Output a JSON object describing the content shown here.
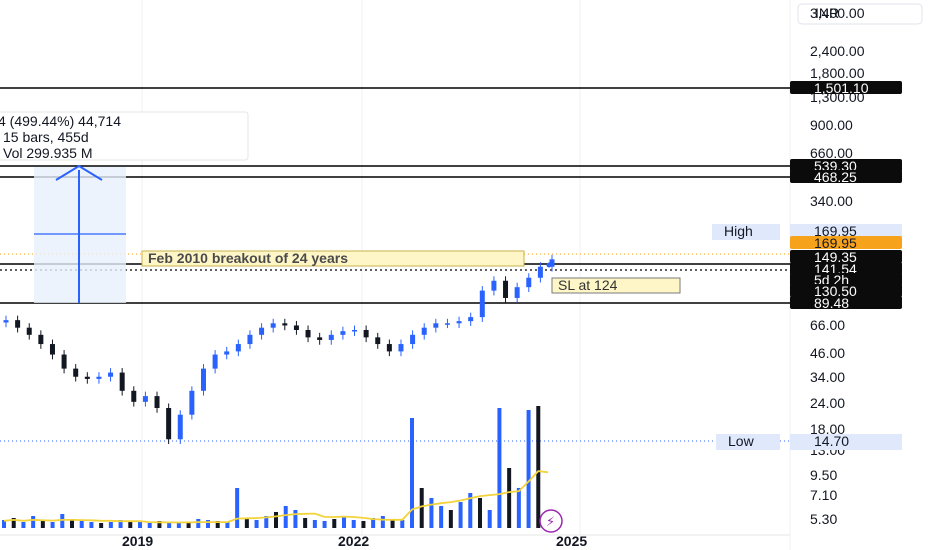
{
  "header": {
    "currency": "INR"
  },
  "measure_tooltip": {
    "line1": "4 (499.44%) 44,714",
    "line2": "15 bars, 455d",
    "line3": "Vol 299.935 M"
  },
  "annotations": {
    "breakout_label": "Feb 2010 breakout of 24 years",
    "stop_loss_label": "SL at 124"
  },
  "markers": {
    "high_label": "High",
    "high_value": "169.95",
    "low_label": "Low",
    "low_value": "14.70"
  },
  "colors": {
    "accent": "#2962ff",
    "candle": "#2962ff",
    "line_black": "#000000",
    "price_tag_orange": "#f7a21b",
    "label_yellow": "#fff6c8",
    "label_blue": "#dfe9fb",
    "volume_ma": "#f2d33a"
  },
  "chart_data": {
    "type": "candlestick",
    "y_scale": "log",
    "x_axis_ticks": [
      "2019",
      "2022",
      "2025"
    ],
    "y_axis_ticks": [
      "3,400.00",
      "2,400.00",
      "1,800.00",
      "1,300.00",
      "900.00",
      "660.00",
      "340.00",
      "66.00",
      "46.00",
      "34.00",
      "24.00",
      "18.00",
      "13.00",
      "9.50",
      "7.10",
      "5.30"
    ],
    "price_tags": [
      {
        "value": "1,501.10",
        "style": "dark"
      },
      {
        "value": "539.30",
        "style": "dark"
      },
      {
        "value": "468.25",
        "style": "dark"
      },
      {
        "value": "169.95",
        "style": "orange"
      },
      {
        "value": "149.35",
        "style": "dark"
      },
      {
        "value": "141.54",
        "style": "dark"
      },
      {
        "value": "5d 2h",
        "style": "dark"
      },
      {
        "value": "130.50",
        "style": "dark"
      },
      {
        "value": "89.48",
        "style": "dark"
      }
    ],
    "horizontal_levels": [
      1501.1,
      539.3,
      468.25,
      149.35,
      130.5,
      89.48
    ],
    "approx_close_series": [
      75,
      68,
      62,
      55,
      48,
      40,
      36,
      35,
      36,
      38,
      30,
      26,
      28,
      24,
      16,
      22,
      30,
      40,
      48,
      50,
      55,
      62,
      68,
      72,
      70,
      66,
      60,
      58,
      62,
      65,
      66,
      60,
      55,
      50,
      55,
      62,
      68,
      72,
      72,
      74,
      78,
      110,
      125,
      100,
      115,
      130,
      150,
      165
    ],
    "volume_spikes_note": "large volume bars around 2022-2024"
  }
}
